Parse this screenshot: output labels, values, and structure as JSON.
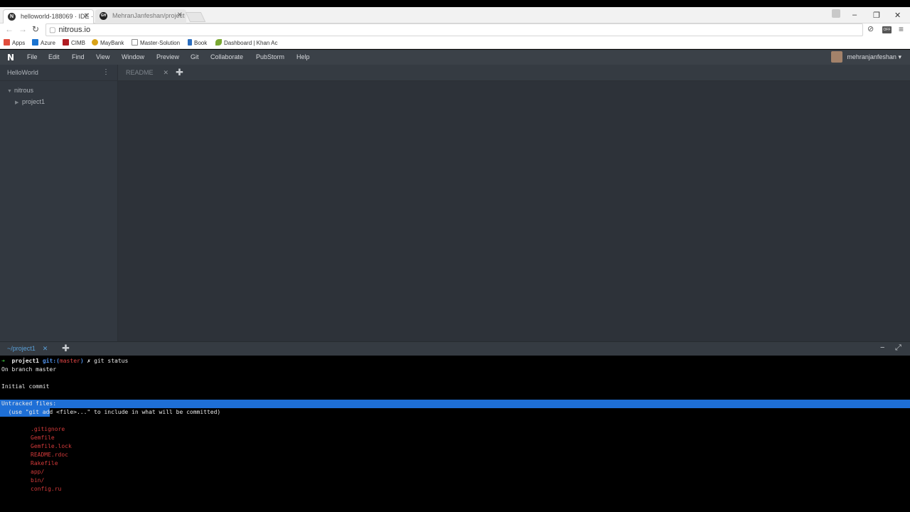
{
  "browser": {
    "tabs": [
      {
        "title": "helloworld-188069 · IDE ·",
        "favicon": "N",
        "active": true
      },
      {
        "title": "MehranJanfeshan/project",
        "favicon": "GH",
        "active": false
      }
    ],
    "url": "nitrous.io",
    "bookmarks": [
      {
        "label": "Apps",
        "color": "#e14d3c"
      },
      {
        "label": "Azure",
        "color": "#1a73d0"
      },
      {
        "label": "CIMB",
        "color": "#b01c22"
      },
      {
        "label": "MayBank",
        "color": "#d9a217"
      },
      {
        "label": "Master-Solution",
        "color": "#8a8a8a"
      },
      {
        "label": "Book",
        "color": "#2d6fbf"
      },
      {
        "label": "Dashboard | Khan Ac",
        "color": "#7aa833"
      }
    ],
    "off_badge": "OFF"
  },
  "ide": {
    "menu": [
      "File",
      "Edit",
      "Find",
      "View",
      "Window",
      "Preview",
      "Git",
      "Collaborate",
      "PubStorm",
      "Help"
    ],
    "username": "mehranjanfeshan",
    "project_title": "HelloWorld",
    "tree": {
      "root": "nitrous",
      "child": "project1"
    },
    "editor_tab": "README",
    "terminal_tab": "~/project1"
  },
  "terminal": {
    "prompt_arrow": "➜",
    "prompt_dir": "project1",
    "prompt_git": "git:(",
    "prompt_branch": "master",
    "prompt_git_close": ")",
    "prompt_dirty": "✗",
    "command": "git status",
    "line_branch": "On branch master",
    "line_initial": "Initial commit",
    "line_untracked": "Untracked files:",
    "line_hint": "  (use \"git add <file>...\" to include in what will be committed)",
    "files": [
      ".gitignore",
      "Gemfile",
      "Gemfile.lock",
      "README.rdoc",
      "Rakefile",
      "app/",
      "bin/",
      "config.ru"
    ]
  }
}
